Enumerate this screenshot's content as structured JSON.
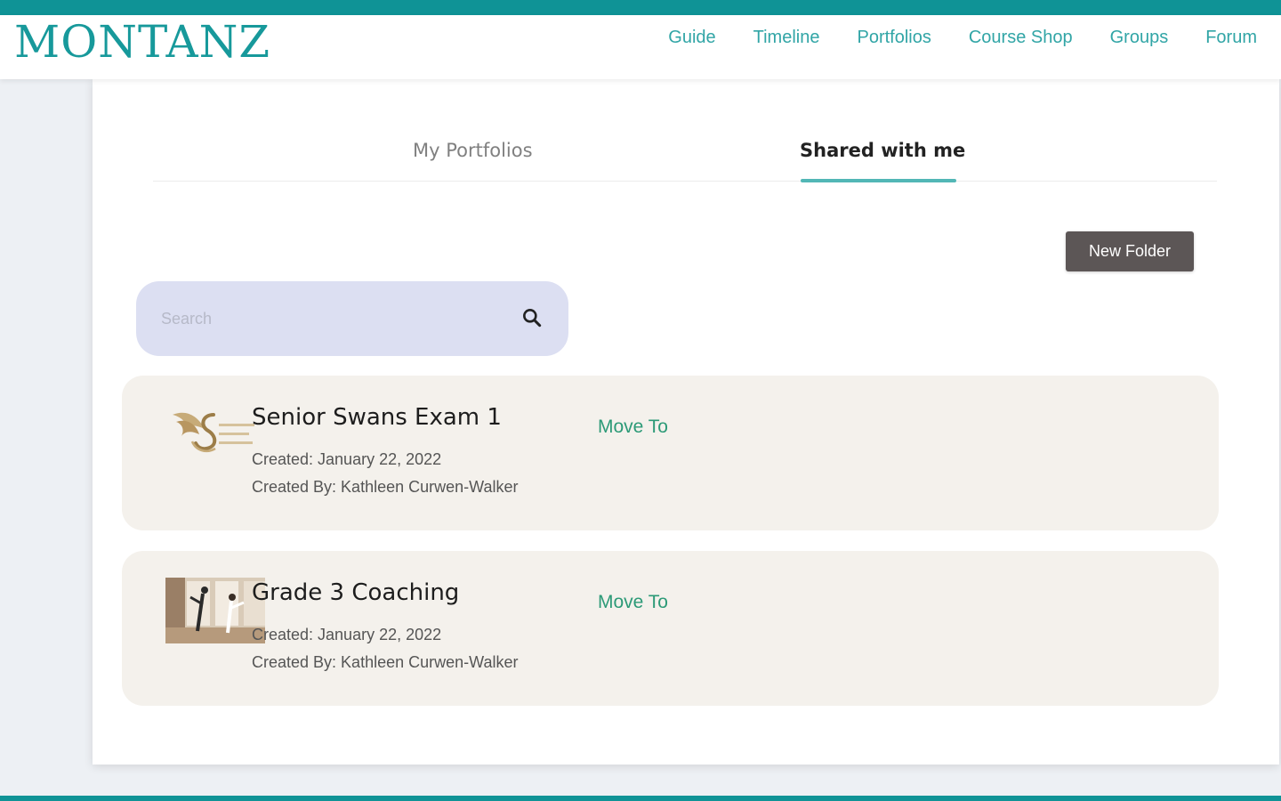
{
  "brand": {
    "logo_text": "MONTANZ",
    "colors": {
      "teal": "#0f9396",
      "nav": "#31a5a6",
      "tab_underline": "#52b7b6",
      "move_to": "#2c9a77",
      "card_bg": "#f4f1ec",
      "search_bg": "#dcdff2",
      "button_bg": "#5c5656"
    }
  },
  "nav": {
    "items": [
      {
        "label": "Guide"
      },
      {
        "label": "Timeline"
      },
      {
        "label": "Portfolios"
      },
      {
        "label": "Course Shop"
      },
      {
        "label": "Groups"
      },
      {
        "label": "Forum"
      }
    ]
  },
  "tabs": {
    "items": [
      {
        "label": "My Portfolios",
        "active": false
      },
      {
        "label": "Shared with me",
        "active": true
      }
    ]
  },
  "toolbar": {
    "new_folder_label": "New Folder"
  },
  "search": {
    "placeholder": "Search",
    "value": "",
    "icon": "search-icon"
  },
  "portfolios": [
    {
      "title": "Senior Swans Exam 1",
      "created": "Created: January 22, 2022",
      "created_by": "Created By: Kathleen Curwen-Walker",
      "action": "Move To",
      "thumbnail": "swan-logo-thumbnail"
    },
    {
      "title": "Grade 3 Coaching",
      "created": "Created: January 22, 2022",
      "created_by": "Created By: Kathleen Curwen-Walker",
      "action": "Move To",
      "thumbnail": "dance-photo-thumbnail"
    }
  ]
}
